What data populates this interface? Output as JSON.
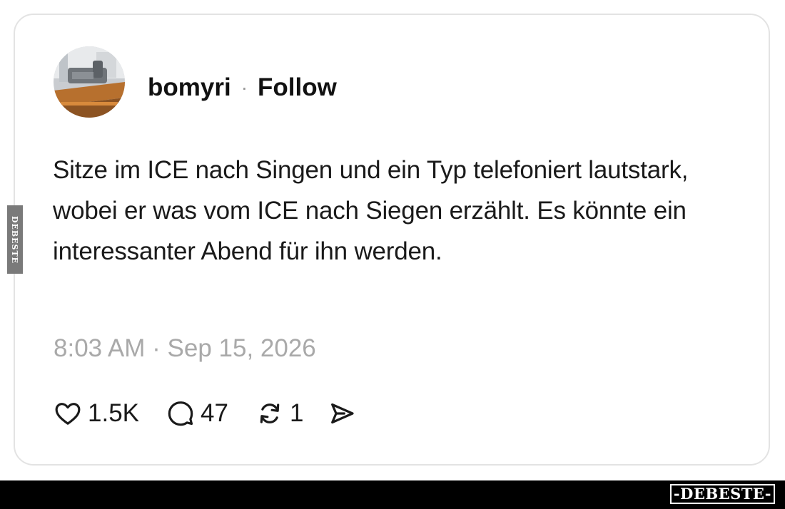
{
  "post": {
    "username": "bomyri",
    "separator": "·",
    "follow_label": "Follow",
    "text": "Sitze im ICE nach Singen und ein Typ telefoniert lautstark, wobei er was vom ICE nach Siegen erzählt. Es könnte ein interessanter Abend für ihn werden.",
    "timestamp": "8:03 AM · Sep 15, 2026"
  },
  "actions": {
    "likes": {
      "icon": "heart-icon",
      "count": "1.5K"
    },
    "replies": {
      "icon": "speech-bubble-icon",
      "count": "47"
    },
    "reposts": {
      "icon": "repost-icon",
      "count": "1"
    },
    "share": {
      "icon": "send-icon"
    }
  },
  "watermark": {
    "side_text": "DEBESTE",
    "logo_text": "-DEBESTE-"
  }
}
